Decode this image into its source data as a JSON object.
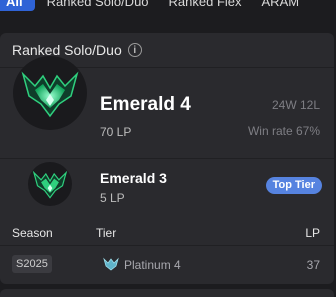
{
  "tabs": [
    {
      "label": "All",
      "active": true
    },
    {
      "label": "Ranked Solo/Duo",
      "active": false
    },
    {
      "label": "Ranked Flex",
      "active": false
    },
    {
      "label": "ARAM",
      "active": false
    }
  ],
  "card": {
    "title": "Ranked Solo/Duo",
    "info_icon": "info-icon",
    "current": {
      "rank": "Emerald 4",
      "lp": "70 LP",
      "record": "24W 12L",
      "win_rate": "Win rate 67%"
    },
    "peak": {
      "rank": "Emerald 3",
      "lp": "5 LP",
      "badge": "Top Tier"
    },
    "table": {
      "headers": {
        "season": "Season",
        "tier": "Tier",
        "lp": "LP"
      },
      "rows": [
        {
          "season": "S2025",
          "tier": "Platinum 4",
          "lp": "37"
        }
      ]
    }
  },
  "colors": {
    "background": "#1c1c1f",
    "card": "#2a2a2e",
    "accent": "#2f63d6",
    "badge": "#5683e0",
    "emerald": "#2fd07e"
  }
}
